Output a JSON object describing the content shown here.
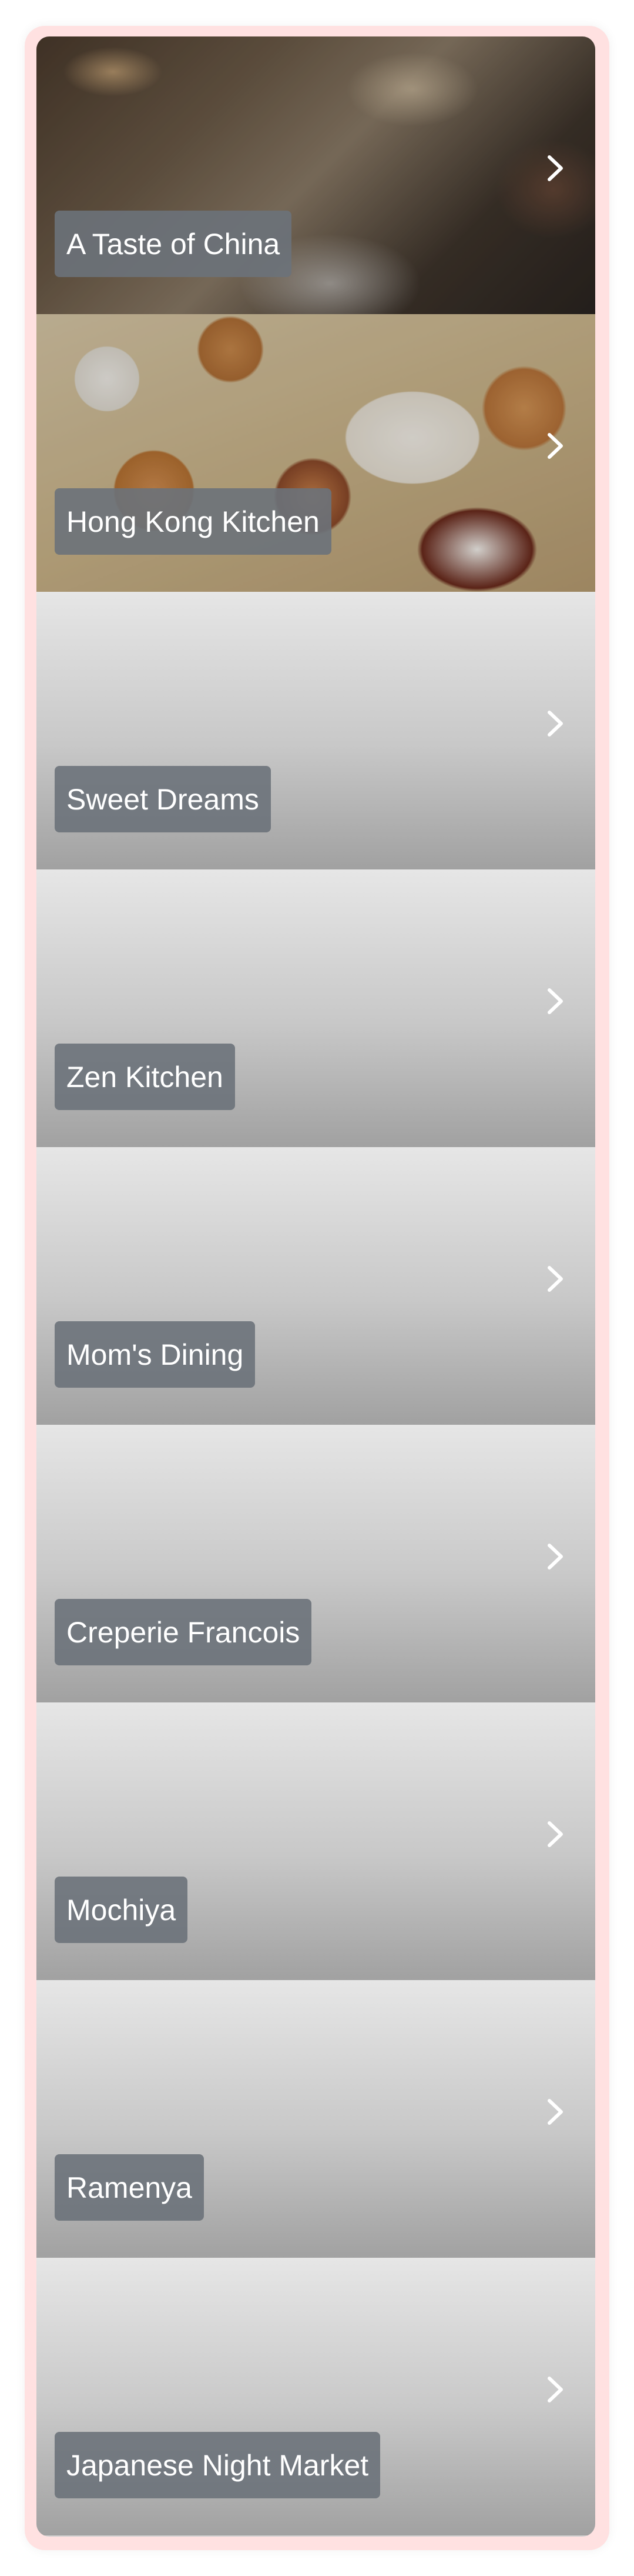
{
  "restaurants": [
    {
      "name": "A Taste of China",
      "image": "photo-noodles"
    },
    {
      "name": "Hong Kong Kitchen",
      "image": "photo-dim-sum"
    },
    {
      "name": "Sweet Dreams",
      "image": "placeholder"
    },
    {
      "name": "Zen Kitchen",
      "image": "placeholder"
    },
    {
      "name": "Mom's Dining",
      "image": "placeholder"
    },
    {
      "name": "Creperie Francois",
      "image": "placeholder"
    },
    {
      "name": "Mochiya",
      "image": "placeholder"
    },
    {
      "name": "Ramenya",
      "image": "placeholder"
    },
    {
      "name": "Japanese Night Market",
      "image": "placeholder"
    }
  ],
  "icons": {
    "chevron": "chevron-right-icon"
  },
  "colors": {
    "frame": "#ffe1e1",
    "label_background": "#6c727a",
    "label_text": "#ffffff"
  }
}
